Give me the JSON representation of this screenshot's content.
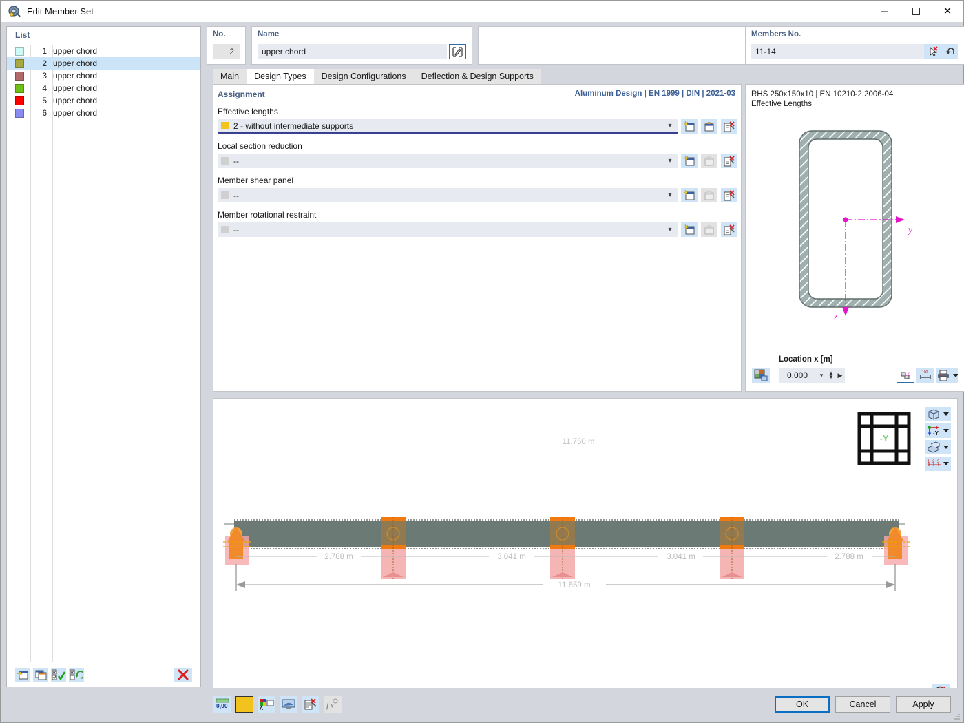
{
  "window": {
    "title": "Edit Member Set",
    "icon": "member-set-icon",
    "minimize": "–",
    "maximize": "□",
    "close": "✕"
  },
  "list_panel": {
    "header": "List",
    "rows": [
      {
        "color": "#ccfbf8",
        "num": "1",
        "name": "upper chord",
        "selected": false
      },
      {
        "color": "#a7a83f",
        "num": "2",
        "name": "upper chord",
        "selected": true
      },
      {
        "color": "#b06a6a",
        "num": "3",
        "name": "upper chord",
        "selected": false
      },
      {
        "color": "#6fbf14",
        "num": "4",
        "name": "upper chord",
        "selected": false
      },
      {
        "color": "#fe0000",
        "num": "5",
        "name": "upper chord",
        "selected": false
      },
      {
        "color": "#8a8bf0",
        "num": "6",
        "name": "upper chord",
        "selected": false
      }
    ],
    "toolbar": [
      {
        "name": "new-member-set-button",
        "icon": "new-window-icon"
      },
      {
        "name": "copy-member-set-button",
        "icon": "copy-window-icon"
      },
      {
        "name": "select-all-button",
        "icon": "checkbox-check-icon"
      },
      {
        "name": "invert-selection-button",
        "icon": "checkbox-refresh-icon"
      },
      {
        "name": "delete-member-set-button",
        "icon": "red-x-icon"
      }
    ]
  },
  "header": {
    "no_label": "No.",
    "no_value": "2",
    "name_label": "Name",
    "name_value": "upper chord",
    "name_placeholder": "upper chord",
    "edit_icon": "pencil-box-icon",
    "members_label": "Members No.",
    "members_value": "11-14",
    "members_placeholder": "11-14",
    "pick_icon": "pick-cursor-icon",
    "undo_icon": "undo-arrow-icon"
  },
  "tabs": [
    {
      "label": "Main",
      "active": false
    },
    {
      "label": "Design Types",
      "active": true
    },
    {
      "label": "Design Configurations",
      "active": false
    },
    {
      "label": "Deflection & Design Supports",
      "active": false
    }
  ],
  "assignment": {
    "title": "Assignment",
    "standard": "Aluminum Design | EN 1999 | DIN | 2021-03",
    "accent_color": "#3c5f94",
    "fields": [
      {
        "label": "Effective lengths",
        "value": "2 - without intermediate supports",
        "swatch": "#f2c31c",
        "active": true,
        "buttons": [
          {
            "name": "new-effective-lengths-button",
            "icon": "new-star-icon",
            "enabled": true
          },
          {
            "name": "edit-effective-lengths-button",
            "icon": "edit-tool-icon",
            "enabled": true
          },
          {
            "name": "delete-effective-lengths-button",
            "icon": "delete-doc-icon",
            "enabled": true
          }
        ]
      },
      {
        "label": "Local section reduction",
        "value": "--",
        "swatch": "#d0d0d0",
        "active": false,
        "buttons": [
          {
            "name": "new-local-section-reduction-button",
            "icon": "new-star-icon",
            "enabled": true
          },
          {
            "name": "edit-local-section-reduction-button",
            "icon": "edit-tool-icon",
            "enabled": false
          },
          {
            "name": "delete-local-section-reduction-button",
            "icon": "delete-doc-icon",
            "enabled": true
          }
        ]
      },
      {
        "label": "Member shear panel",
        "value": "--",
        "swatch": "#d0d0d0",
        "active": false,
        "buttons": [
          {
            "name": "new-member-shear-panel-button",
            "icon": "new-star-icon",
            "enabled": true
          },
          {
            "name": "edit-member-shear-panel-button",
            "icon": "edit-tool-icon",
            "enabled": false
          },
          {
            "name": "delete-member-shear-panel-button",
            "icon": "delete-doc-icon",
            "enabled": true
          }
        ]
      },
      {
        "label": "Member rotational restraint",
        "value": "--",
        "swatch": "#d0d0d0",
        "active": false,
        "buttons": [
          {
            "name": "new-member-rotational-restraint-button",
            "icon": "new-star-icon",
            "enabled": true
          },
          {
            "name": "edit-member-rotational-restraint-button",
            "icon": "edit-tool-icon",
            "enabled": false
          },
          {
            "name": "delete-member-rotational-restraint-button",
            "icon": "delete-doc-icon",
            "enabled": true
          }
        ]
      }
    ]
  },
  "section_panel": {
    "title_line1": "RHS 250x150x10 | EN 10210-2:2006-04",
    "title_line2": "Effective Lengths",
    "axis_y_label": "y",
    "axis_z_label": "z",
    "axis_color": "#e315c8",
    "hatch_color": "#8a9a99",
    "location_label": "Location x [m]",
    "location_value": "0.000",
    "buttons": [
      {
        "name": "section-image-button",
        "icon": "image-picker-icon"
      },
      {
        "name": "section-axes-toggle-button",
        "icon": "axes-section-icon"
      },
      {
        "name": "section-dimensions-button",
        "icon": "dimension-icon"
      },
      {
        "name": "section-print-button",
        "icon": "printer-icon"
      }
    ]
  },
  "viewport": {
    "top_dimension": "11.750 m",
    "total_dimension": "11.659 m",
    "segments": [
      "2.788 m",
      "3.041 m",
      "3.041 m",
      "2.788 m"
    ],
    "beam_color": "#6b7a74",
    "support_color": "#f7a3a3",
    "node_color": "#f08a2a",
    "nav_cube_label": "-Y",
    "tools": [
      {
        "name": "view-render-mode-button",
        "icon": "cube-wire-icon"
      },
      {
        "name": "view-axis-button",
        "icon": "axes-xyz-icon"
      },
      {
        "name": "view-layers-button",
        "icon": "layers-icon"
      },
      {
        "name": "view-numbering-button",
        "icon": "numbering-123-icon"
      }
    ],
    "zoom_button": {
      "name": "zoom-reset-button",
      "icon": "magnifier-x-icon"
    }
  },
  "bottom": {
    "tools": [
      {
        "name": "decimal-places-button",
        "icon": "decimal-000-icon",
        "enabled": true
      },
      {
        "name": "color-swatch-button",
        "icon": "yellow-swatch-icon",
        "enabled": true
      },
      {
        "name": "color-legend-button",
        "icon": "color-legend-icon",
        "enabled": true
      },
      {
        "name": "display-settings-button",
        "icon": "monitor-icon",
        "enabled": true
      },
      {
        "name": "delete-entry-button",
        "icon": "delete-doc-icon",
        "enabled": true
      },
      {
        "name": "formula-button",
        "icon": "formula-fx-icon",
        "enabled": false
      }
    ],
    "ok_label": "OK",
    "cancel_label": "Cancel",
    "apply_label": "Apply"
  }
}
